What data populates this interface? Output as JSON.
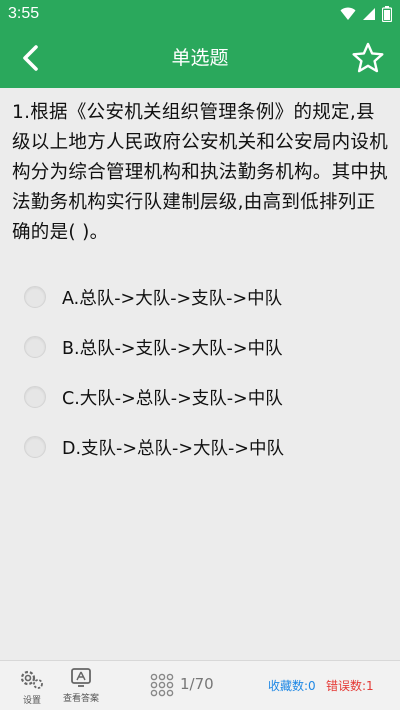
{
  "status_bar": {
    "time": "3:55",
    "icons": [
      "wifi-icon",
      "signal-icon",
      "battery-icon"
    ]
  },
  "app_bar": {
    "title": "单选题",
    "back_icon": "chevron-left-icon",
    "favorite_icon": "star-outline-icon",
    "color": "#2aa85c"
  },
  "question": {
    "text": "1.根据《公安机关组织管理条例》的规定,县级以上地方人民政府公安机关和公安局内设机构分为综合管理机构和执法勤务机构。其中执法勤务机构实行队建制层级,由高到低排列正确的是(   )。"
  },
  "options": [
    {
      "label": "A.总队->大队->支队->中队"
    },
    {
      "label": "B.总队->支队->大队->中队"
    },
    {
      "label": "C.大队->总队->支队->中队"
    },
    {
      "label": "D.支队->总队->大队->中队"
    }
  ],
  "bottom_bar": {
    "settings_label": "设置",
    "answer_label": "查看答案",
    "progress": "1/70",
    "favorites": "收藏数:0",
    "errors": "错误数:1",
    "favorites_color": "#1e88e5",
    "errors_color": "#e53935"
  }
}
